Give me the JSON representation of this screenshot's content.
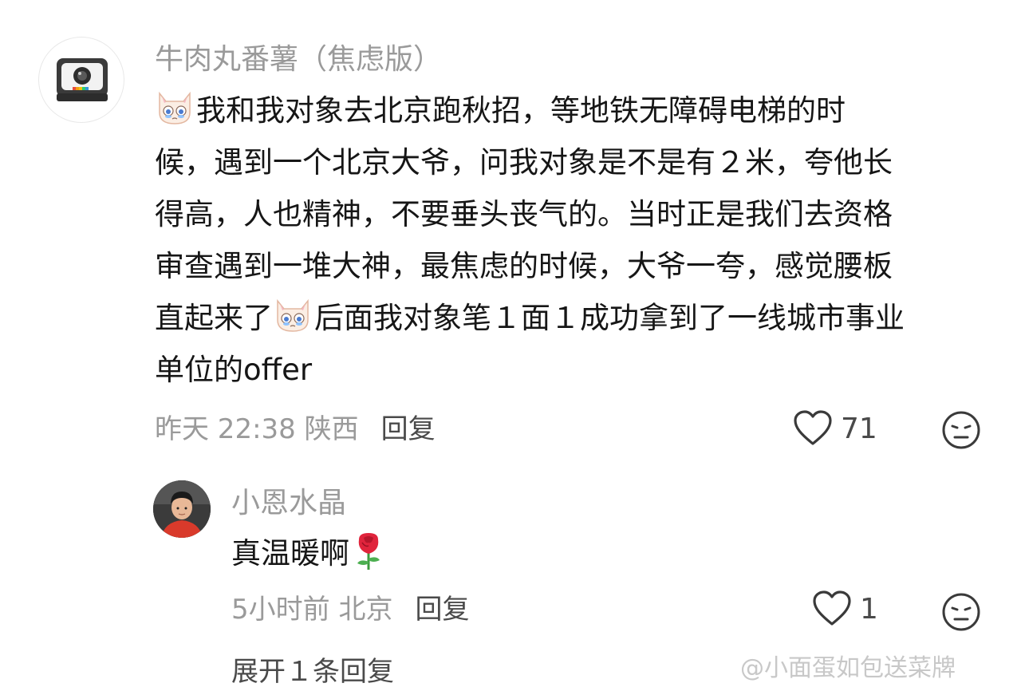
{
  "comment": {
    "username": "牛肉丸番薯（焦虑版）",
    "emoji": "crying-cat-emoji",
    "lines": [
      "我和我对象去北京跑秋招，等地铁无障碍电梯的时",
      "候，遇到一个北京大爷，问我对象是不是有２米，夸他长",
      "得高，人也精神，不要垂头丧气的。当时正是我们去资格",
      "审查遇到一堆大神，最焦虑的时候，大爷一夸，感觉腰板",
      "直起来了",
      "后面我对象笔１面１成功拿到了一线城市事业",
      "单位的offer"
    ],
    "time": "昨天 22:38 陕西",
    "reply_label": "回复",
    "like_count": "71"
  },
  "sub_comment": {
    "username": "小恩水晶",
    "text": "真温暖啊",
    "emoji": "rose-emoji",
    "time": "5小时前 北京",
    "reply_label": "回复",
    "like_count": "1"
  },
  "expand_text": "展开１条回复",
  "watermark": "@小面蛋如包送菜牌",
  "colors": {
    "text": "#161616",
    "muted": "#9a9a9a",
    "action": "#4a4a4a",
    "background": "#ffffff"
  }
}
